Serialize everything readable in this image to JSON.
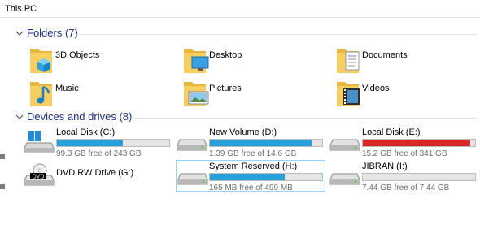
{
  "address": {
    "location": "This PC"
  },
  "folders_group": {
    "title": "Folders (7)"
  },
  "folders": [
    {
      "label": "3D Objects",
      "icon": "3d-objects-folder-icon"
    },
    {
      "label": "Desktop",
      "icon": "desktop-folder-icon"
    },
    {
      "label": "Documents",
      "icon": "documents-folder-icon"
    },
    {
      "label": "Music",
      "icon": "music-folder-icon"
    },
    {
      "label": "Pictures",
      "icon": "pictures-folder-icon"
    },
    {
      "label": "Videos",
      "icon": "videos-folder-icon"
    }
  ],
  "drives_group": {
    "title": "Devices and drives (8)"
  },
  "drives": [
    {
      "name": "Local Disk (C:)",
      "free": "99.3 GB free of 243 GB",
      "used_fraction": 0.59,
      "color": "#26a0da",
      "icon": "windows-drive-icon",
      "selected": false
    },
    {
      "name": "New Volume (D:)",
      "free": "1.39 GB free of 14.6 GB",
      "used_fraction": 0.905,
      "color": "#26a0da",
      "icon": "hard-drive-icon",
      "selected": false
    },
    {
      "name": "Local Disk (E:)",
      "free": "15.2 GB free of 341 GB",
      "used_fraction": 0.955,
      "color": "#da2626",
      "icon": "hard-drive-icon",
      "selected": false
    },
    {
      "name": "DVD RW Drive (G:)",
      "free": "",
      "used_fraction": null,
      "color": "",
      "icon": "dvd-drive-icon",
      "badge": "DVD",
      "selected": false
    },
    {
      "name": "System Reserved (H:)",
      "free": "165 MB free of 499 MB",
      "used_fraction": 0.67,
      "color": "#26a0da",
      "icon": "hard-drive-icon",
      "selected": true
    },
    {
      "name": "JIBRAN (I:)",
      "free": "7.44 GB free of 7.44 GB",
      "used_fraction": 0.0,
      "color": "#26a0da",
      "icon": "hard-drive-icon",
      "selected": false
    }
  ]
}
